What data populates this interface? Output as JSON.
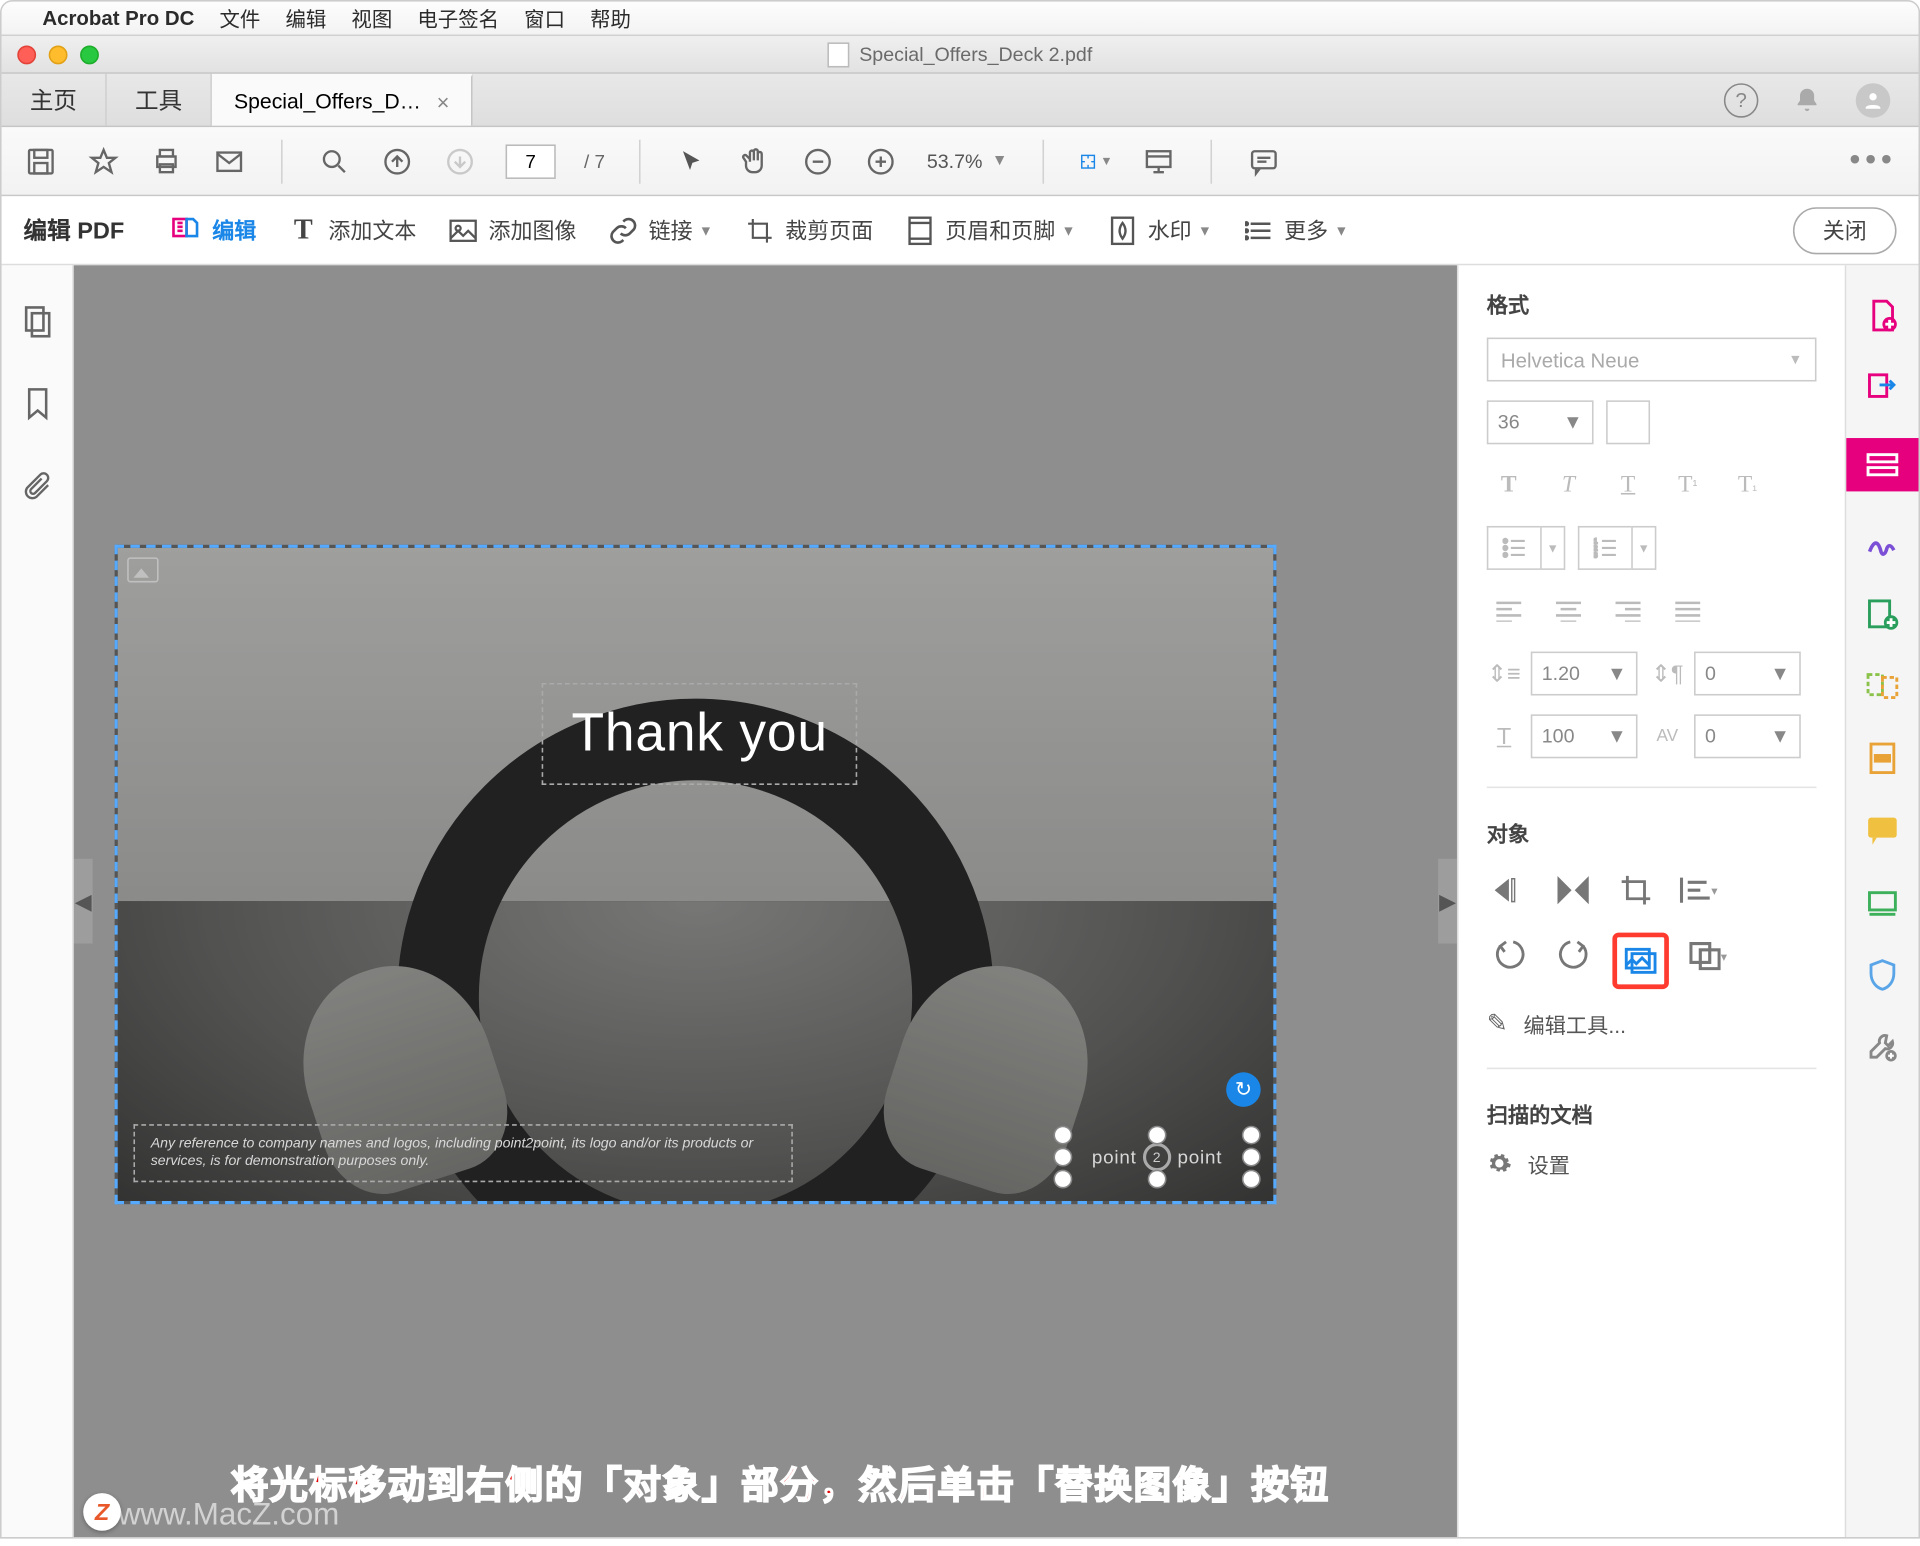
{
  "mac_menu": {
    "app_name": "Acrobat Pro DC",
    "items": [
      "文件",
      "编辑",
      "视图",
      "电子签名",
      "窗口",
      "帮助"
    ]
  },
  "window": {
    "title": "Special_Offers_Deck 2.pdf"
  },
  "tabs": {
    "home": "主页",
    "tools": "工具",
    "doc": "Special_Offers_D…"
  },
  "toolbar": {
    "page_current": "7",
    "page_total": "/ 7",
    "zoom": "53.7%"
  },
  "editbar": {
    "title": "编辑 PDF",
    "edit": "编辑",
    "add_text": "添加文本",
    "add_image": "添加图像",
    "link": "链接",
    "crop": "裁剪页面",
    "header_footer": "页眉和页脚",
    "watermark": "水印",
    "more": "更多",
    "close": "关闭"
  },
  "slide": {
    "thank_you": "Thank you",
    "disclaimer": "Any reference to company names and logos, including point2point, its logo and/or its products or services, is for demonstration purposes only.",
    "logo_left": "point",
    "logo_mid": "2",
    "logo_right": "point"
  },
  "format_panel": {
    "header": "格式",
    "font": "Helvetica Neue",
    "size": "36",
    "line_spacing": "1.20",
    "para_spacing": "0",
    "hscale": "100",
    "tracking": "0",
    "object_header": "对象",
    "edit_tools": "编辑工具...",
    "scanned_header": "扫描的文档",
    "settings": "设置"
  },
  "annotation": "将光标移动到右侧的「对象」部分，然后单击「替换图像」按钮",
  "watermark": "www.MacZ.com",
  "badge": "Z"
}
